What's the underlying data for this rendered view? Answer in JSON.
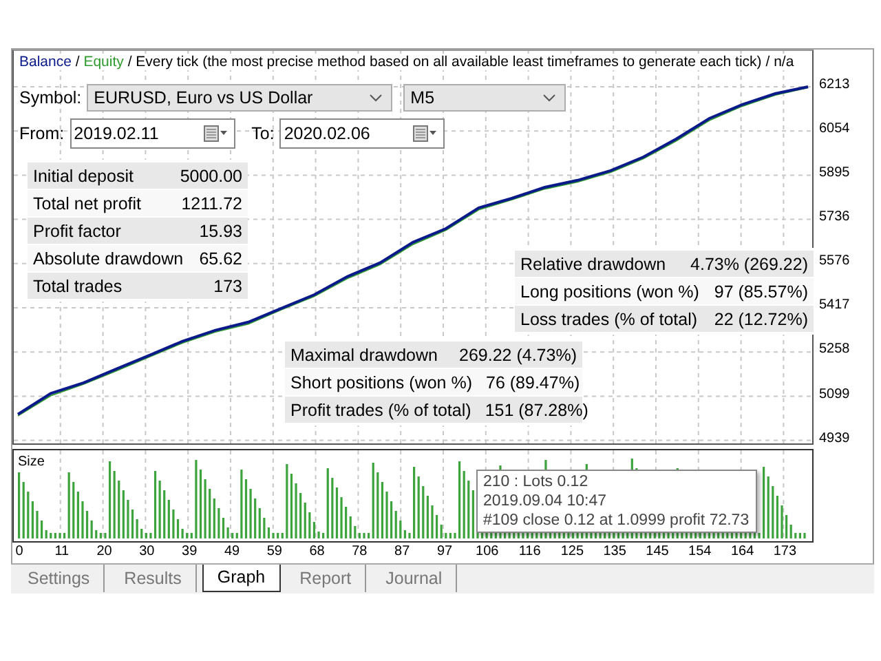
{
  "legend": {
    "separator": "/",
    "items": [
      "Every tick (the most precise method based on all available least timeframes to generate each tick)",
      "n/a"
    ]
  },
  "symbol": {
    "label": "Symbol:",
    "value": "EURUSD, Euro vs US Dollar",
    "period": "M5"
  },
  "dates": {
    "from_label": "From:",
    "from": "2019.02.11",
    "to_label": "To:",
    "to": "2020.02.06"
  },
  "stats_left": [
    {
      "label": "Initial deposit",
      "value": "5000.00"
    },
    {
      "label": "Total net profit",
      "value": "1211.72"
    },
    {
      "label": "Profit factor",
      "value": "15.93"
    },
    {
      "label": "Absolute drawdown",
      "value": "65.62"
    },
    {
      "label": "Total trades",
      "value": "173"
    }
  ],
  "stats_right": [
    {
      "label": "Relative drawdown",
      "value": "4.73% (269.22)"
    },
    {
      "label": "Long positions (won %)",
      "value": "97 (85.57%)"
    },
    {
      "label": "Loss trades (% of total)",
      "value": "22 (12.72%)"
    }
  ],
  "stats_middle": [
    {
      "label": "Maximal drawdown",
      "value": "269.22 (4.73%)"
    },
    {
      "label": "Short positions (won %)",
      "value": "76 (89.47%)"
    },
    {
      "label": "Profit trades (% of total)",
      "value": "151 (87.28%)"
    }
  ],
  "chart_data": {
    "type": "line",
    "categories": [
      null,
      null,
      null,
      null,
      null,
      null,
      null,
      null,
      null,
      null,
      null,
      null,
      null,
      null,
      null,
      null,
      null,
      null,
      null,
      null,
      null,
      null,
      null,
      null,
      null
    ],
    "ylim": [
      4939,
      6213
    ],
    "grid": true,
    "yticks": [
      6213,
      6054,
      5895,
      5736,
      5576,
      5417,
      5258,
      5099,
      4939
    ],
    "series": [
      {
        "name": "Balance",
        "color": "#0b1a8a",
        "values": [
          5033,
          5108,
          5147,
          5197,
          5246,
          5296,
          5336,
          5365,
          5415,
          5464,
          5529,
          5579,
          5653,
          5702,
          5777,
          5811,
          5851,
          5876,
          5911,
          5960,
          6025,
          6099,
          6149,
          6188,
          6213
        ]
      },
      {
        "name": "Equity",
        "color": "#2e9a2e",
        "values": [
          5028,
          5100,
          5142,
          5190,
          5240,
          5290,
          5330,
          5358,
          5410,
          5458,
          5522,
          5572,
          5645,
          5696,
          5770,
          5806,
          5845,
          5870,
          5905,
          5954,
          6018,
          6092,
          6143,
          6183,
          6210
        ]
      }
    ]
  },
  "size_pane": {
    "title": "Size"
  },
  "x_axis": [
    "0",
    "11",
    "20",
    "30",
    "39",
    "49",
    "59",
    "68",
    "78",
    "87",
    "97",
    "106",
    "116",
    "125",
    "135",
    "145",
    "154",
    "164",
    "173"
  ],
  "tooltip": [
    "210 : Lots 0.12",
    "2019.09.04 10:47",
    "#109 close 0.12 at 1.0999 profit 72.73"
  ],
  "tabs": [
    {
      "label": "Settings",
      "selected": false
    },
    {
      "label": "Results",
      "selected": false
    },
    {
      "label": "Graph",
      "selected": true
    },
    {
      "label": "Report",
      "selected": false
    },
    {
      "label": "Journal",
      "selected": false
    }
  ]
}
